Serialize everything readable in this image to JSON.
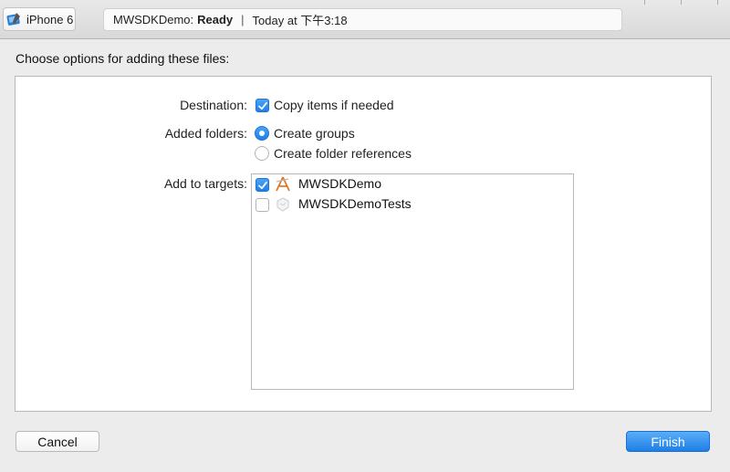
{
  "toolbar": {
    "device": "iPhone 6",
    "status_project": "MWSDKDemo:",
    "status_state": "Ready",
    "status_separator": "|",
    "status_time": "Today at 下午3:18"
  },
  "dialog": {
    "title": "Choose options for adding these files:",
    "destination": {
      "label": "Destination:",
      "option": "Copy items if needed",
      "checked": true
    },
    "added_folders": {
      "label": "Added folders:",
      "options": [
        {
          "label": "Create groups",
          "selected": true
        },
        {
          "label": "Create folder references",
          "selected": false
        }
      ]
    },
    "targets": {
      "label": "Add to targets:",
      "items": [
        {
          "name": "MWSDKDemo",
          "checked": true,
          "icon": "app-target-icon"
        },
        {
          "name": "MWSDKDemoTests",
          "checked": false,
          "icon": "test-target-icon"
        }
      ]
    },
    "buttons": {
      "cancel": "Cancel",
      "finish": "Finish"
    }
  },
  "colors": {
    "accent": "#1f7fe8",
    "background": "#ececec",
    "panel": "#ffffff"
  }
}
